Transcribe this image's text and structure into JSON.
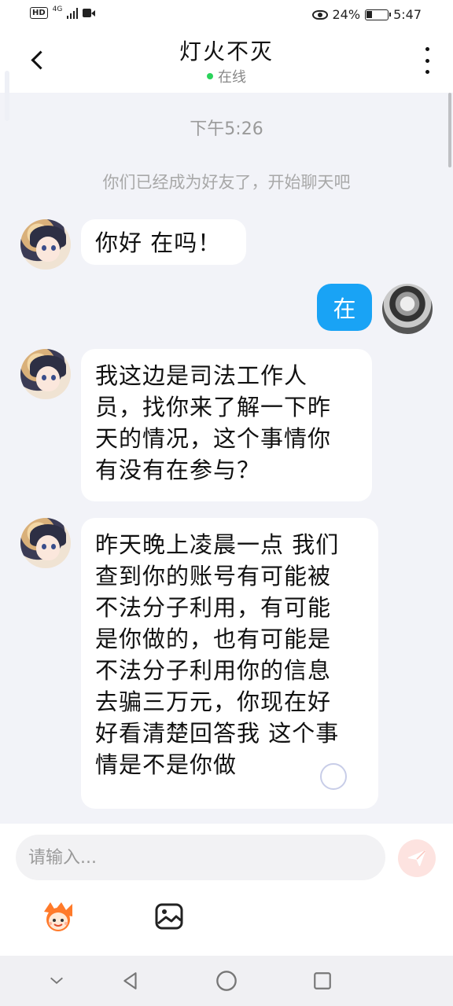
{
  "status_bar": {
    "hd": "HD",
    "network": "4G",
    "battery_percent": "24%",
    "time": "5:47"
  },
  "header": {
    "title": "灯火不灭",
    "status": "在线"
  },
  "chat": {
    "timestamp": "下午5:26",
    "system_message": "你们已经成为好友了，开始聊天吧",
    "messages": [
      {
        "from": "them",
        "lines": [
          "你好 在吗！"
        ]
      },
      {
        "from": "me",
        "lines": [
          "在"
        ]
      },
      {
        "from": "them",
        "lines": [
          "我这边是司法工作人",
          "员，找你来了解一下昨",
          "天的情况，这个事情你",
          "有没有在参与？"
        ]
      },
      {
        "from": "them",
        "lines": [
          "昨天晚上凌晨一点 我们",
          "查到你的账号有可能被",
          "不法分子利用，有可能",
          "是你做的，也有可能是",
          "不法分子利用你的信息",
          "去骗三万元，你现在好",
          "好看清楚回答我 这个事",
          "情是不是你做"
        ]
      }
    ]
  },
  "input": {
    "placeholder": "请输入..."
  },
  "colors": {
    "accent_blue": "#19a3f5",
    "online_green": "#2bd35b",
    "send_disabled": "#fde3e0"
  }
}
